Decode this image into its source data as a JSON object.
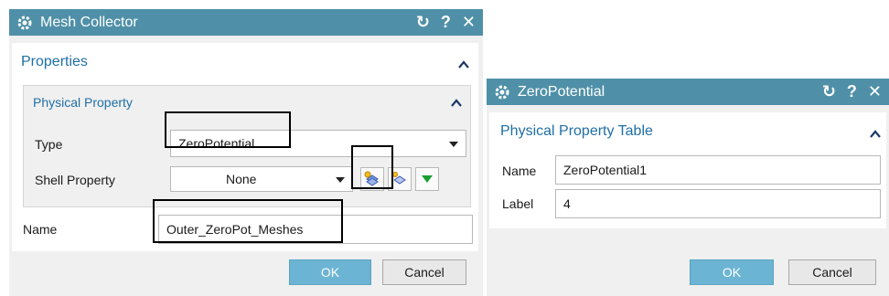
{
  "mesh_collector": {
    "title": "Mesh Collector",
    "reset_glyph": "↻",
    "help_glyph": "?",
    "close_glyph": "✕",
    "properties_label": "Properties",
    "physical_property_label": "Physical Property",
    "type_label": "Type",
    "type_value": "ZeroPotential",
    "shell_label": "Shell Property",
    "shell_value": "None",
    "name_label": "Name",
    "name_value": "Outer_ZeroPot_Meshes",
    "ok_label": "OK",
    "cancel_label": "Cancel"
  },
  "zero_potential": {
    "title": "ZeroPotential",
    "reset_glyph": "↻",
    "help_glyph": "?",
    "close_glyph": "✕",
    "section_label": "Physical Property Table",
    "name_label": "Name",
    "name_value": "ZeroPotential1",
    "label_label": "Label",
    "label_value": "4",
    "ok_label": "OK",
    "cancel_label": "Cancel"
  },
  "colors": {
    "titlebar": "#4f90a8",
    "section_text": "#1f6fa6",
    "ok_button": "#6cb4d3",
    "dialog_bg": "#f0f0f0"
  },
  "icons": [
    "gear-icon",
    "reset-icon",
    "help-icon",
    "close-icon",
    "collapse-chevron-icon",
    "dropdown-arrow-icon",
    "create-property-icon",
    "edit-property-icon",
    "green-dropdown-icon"
  ]
}
